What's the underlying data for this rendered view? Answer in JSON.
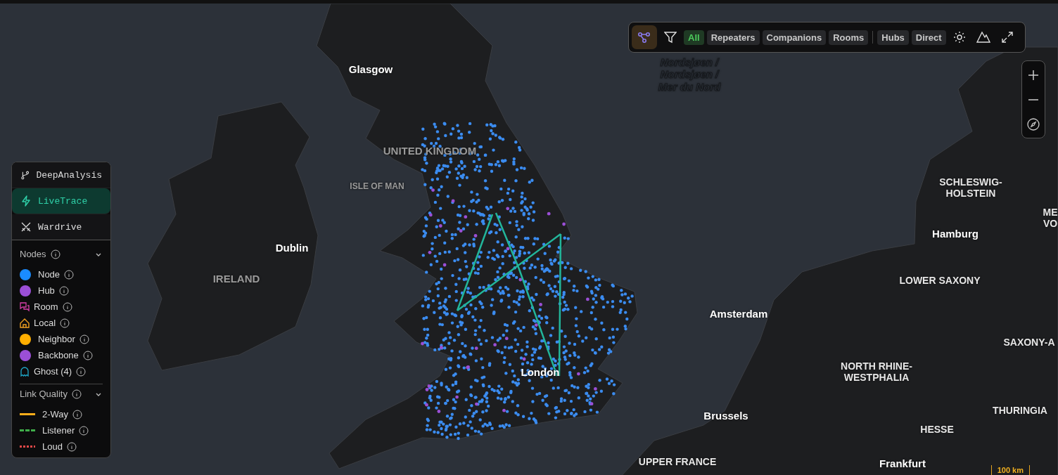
{
  "toolbar": {
    "mode_button": {
      "selected": true
    },
    "type_filters": [
      {
        "label": "All",
        "selected": true
      },
      {
        "label": "Repeaters",
        "selected": false
      },
      {
        "label": "Companions",
        "selected": false
      },
      {
        "label": "Rooms",
        "selected": false
      }
    ],
    "link_filters": [
      {
        "label": "Hubs",
        "selected": false
      },
      {
        "label": "Direct",
        "selected": false
      }
    ]
  },
  "side_tabs": [
    {
      "label": "DeepAnalysis",
      "selected": false,
      "kind": "branch"
    },
    {
      "label": "LiveTrace",
      "selected": true,
      "kind": "bolt"
    },
    {
      "label": "Wardrive",
      "selected": false,
      "kind": "swords"
    }
  ],
  "legend": {
    "nodes": {
      "title": "Nodes",
      "expanded": true,
      "items": [
        {
          "label": "Node",
          "kind": "dot",
          "color": "#1a8cff"
        },
        {
          "label": "Hub",
          "kind": "dot",
          "color": "#9b4fd6"
        },
        {
          "label": "Room",
          "kind": "room"
        },
        {
          "label": "Local",
          "kind": "local"
        },
        {
          "label": "Neighbor",
          "kind": "dot",
          "color": "#ffae00"
        },
        {
          "label": "Backbone",
          "kind": "dot",
          "color": "#9b4fd6"
        },
        {
          "label": "Ghost (4)",
          "kind": "ghost"
        }
      ]
    },
    "link_quality": {
      "title": "Link Quality",
      "expanded": true,
      "items": [
        {
          "label": "2-Way",
          "kind": "solid",
          "color": "#ffae1a"
        },
        {
          "label": "Listener",
          "kind": "dashed",
          "color": "#3fae4a"
        },
        {
          "label": "Loud",
          "kind": "dotted",
          "color": "#e04848"
        }
      ]
    }
  },
  "map": {
    "labels": [
      {
        "text": "Glasgow",
        "kind": "city"
      },
      {
        "text": "UNITED KINGDOM",
        "kind": "region"
      },
      {
        "text": "ISLE OF MAN",
        "kind": "small"
      },
      {
        "text": "Dublin",
        "kind": "city"
      },
      {
        "text": "IRELAND",
        "kind": "region"
      },
      {
        "text": "London",
        "kind": "city"
      },
      {
        "text": "Amsterdam",
        "kind": "city"
      },
      {
        "text": "Brussels",
        "kind": "city"
      },
      {
        "text": "UPPER FRANCE",
        "kind": "region2"
      },
      {
        "text": "Frankfurt",
        "kind": "city"
      },
      {
        "text": "HESSE",
        "kind": "region2"
      },
      {
        "text": "THURINGIA",
        "kind": "region2"
      },
      {
        "text": "NORTH RHINE-\nWESTPHALIA",
        "kind": "region2"
      },
      {
        "text": "SCHLESWIG-\nHOLSTEIN",
        "kind": "region2"
      },
      {
        "text": "Hamburg",
        "kind": "city"
      },
      {
        "text": "LOWER SAXONY",
        "kind": "region2"
      },
      {
        "text": "ME\nVO",
        "kind": "region2"
      },
      {
        "text": "SAXONY-A",
        "kind": "region2"
      },
      {
        "text": "Nordsjøen /\nNordsjøen /\nMer du Nord",
        "kind": "sea"
      }
    ],
    "scale": "100 km"
  }
}
